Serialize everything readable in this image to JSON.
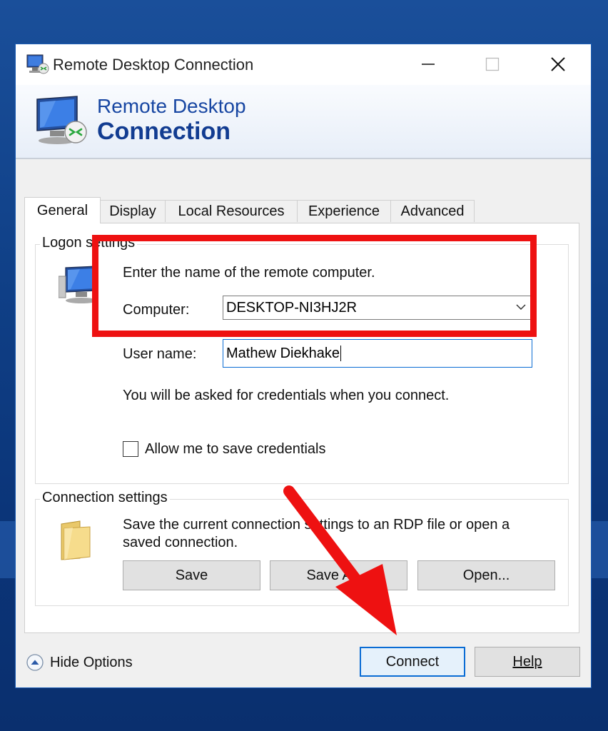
{
  "window": {
    "title": "Remote Desktop Connection",
    "banner_line1": "Remote Desktop",
    "banner_line2": "Connection"
  },
  "tabs": [
    {
      "label": "General",
      "active": true
    },
    {
      "label": "Display"
    },
    {
      "label": "Local Resources"
    },
    {
      "label": "Experience"
    },
    {
      "label": "Advanced"
    }
  ],
  "logon": {
    "title": "Logon settings",
    "instruction": "Enter the name of the remote computer.",
    "computer_label": "Computer:",
    "computer_value": "DESKTOP-NI3HJ2R",
    "username_label": "User name:",
    "username_value": "Mathew Diekhake",
    "credentials_note": "You will be asked for credentials when you connect.",
    "save_credentials_label": "Allow me to save credentials",
    "save_credentials_checked": false
  },
  "connection": {
    "title": "Connection settings",
    "description_line1": "Save the current connection settings to an RDP file or open a",
    "description_line2": "saved connection.",
    "save_label": "Save",
    "save_as_label": "Save As...",
    "open_label": "Open..."
  },
  "footer": {
    "hide_options_label": "Hide Options",
    "connect_label": "Connect",
    "help_label": "Help"
  },
  "annotations": {
    "highlight_color": "#ee1111",
    "arrow_color": "#ee1111"
  }
}
